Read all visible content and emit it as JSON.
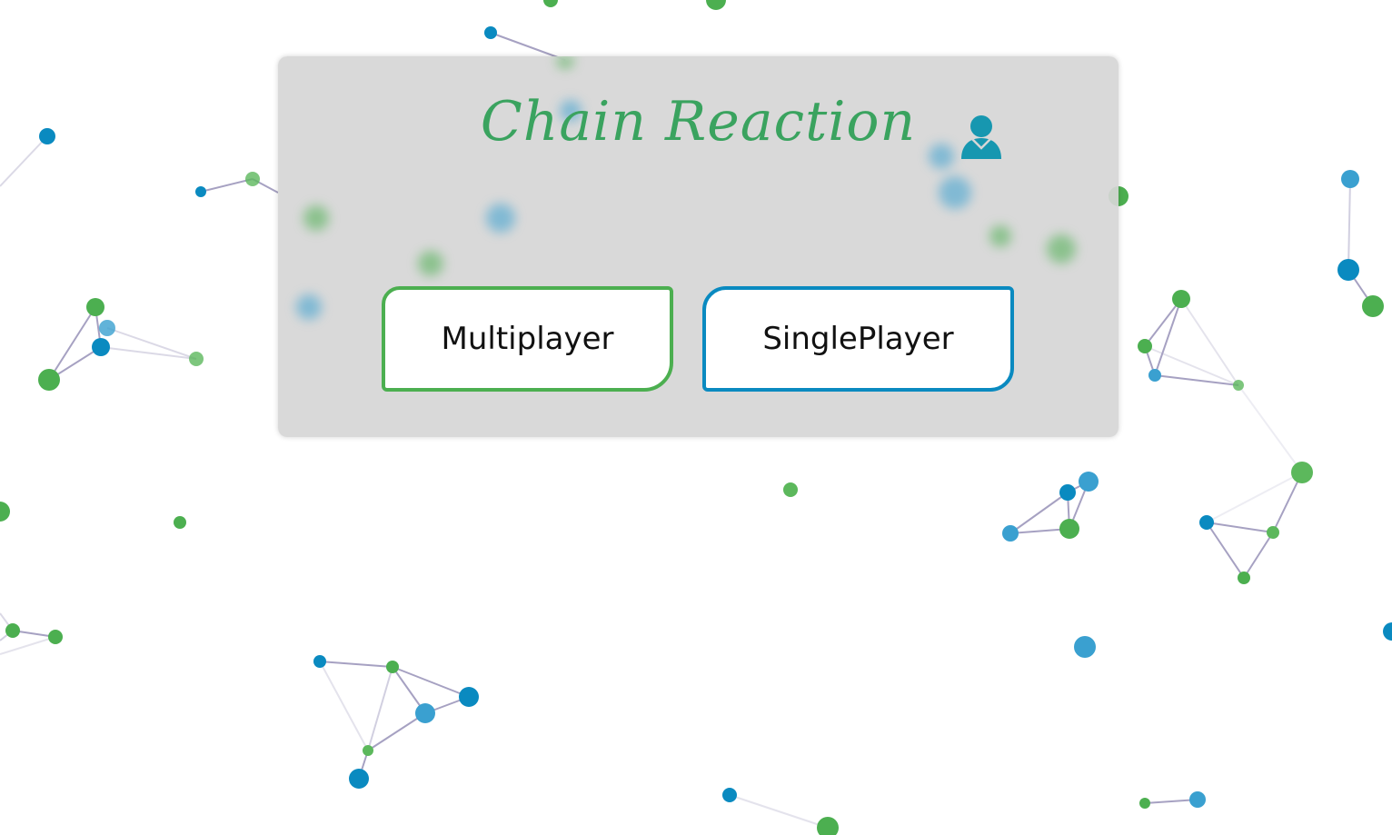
{
  "app": {
    "title": "Chain Reaction"
  },
  "menu": {
    "multiplayer_label": "Multiplayer",
    "singleplayer_label": "SinglePlayer"
  },
  "icons": {
    "profile": "user-icon"
  },
  "colors": {
    "title": "#3aa35f",
    "multiplayer_border": "#4caf50",
    "singleplayer_border": "#0a8ac0",
    "node_green": "#4caf50",
    "node_blue": "#0a8ac0",
    "edge": "#6b6399"
  }
}
